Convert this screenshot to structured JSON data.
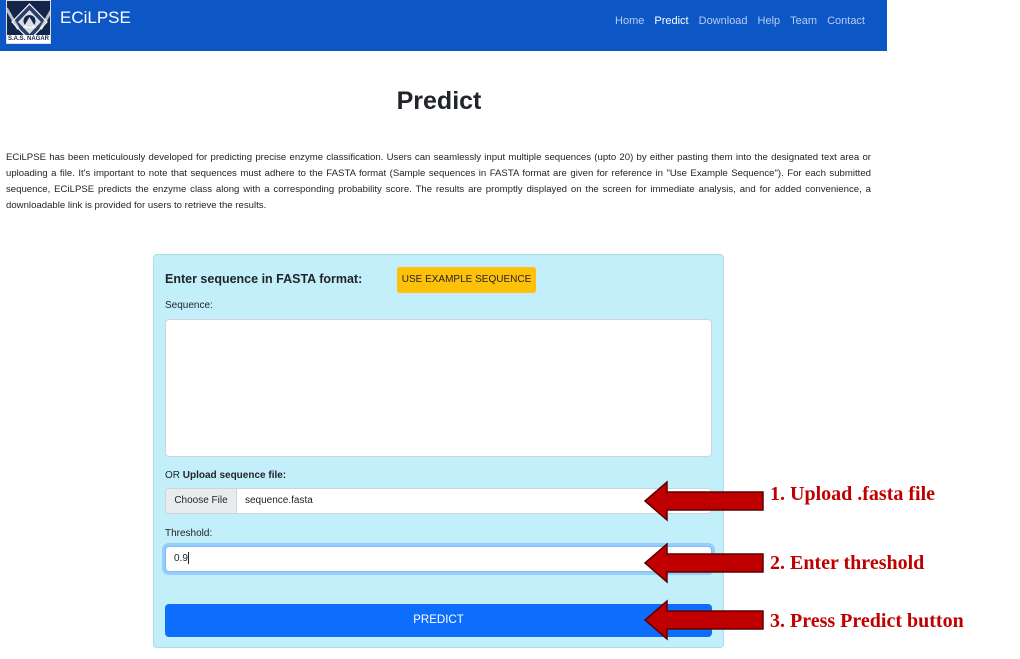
{
  "navbar": {
    "logo_caption": "S.A.S. NAGAR",
    "brand": "ECiLPSE",
    "links": [
      "Home",
      "Predict",
      "Download",
      "Help",
      "Team",
      "Contact"
    ],
    "active_link": "Predict"
  },
  "page": {
    "title": "Predict",
    "intro": "ECiLPSE has been meticulously developed for predicting precise enzyme classification. Users can seamlessly input multiple sequences (upto 20) by either pasting them into the designated text area or uploading a file. It's important to note that sequences must adhere to the FASTA format (Sample sequences in FASTA format are given for reference in \"Use Example Sequence\"). For each submitted sequence, ECiLPSE predicts the enzyme class along with a corresponding probability score. The results are promptly displayed on the screen for immediate analysis, and for added convenience, a downloadable link is provided for users to retrieve the results."
  },
  "form": {
    "heading": "Enter sequence in FASTA format:",
    "example_button": "USE EXAMPLE SEQUENCE",
    "sequence_label": "Sequence:",
    "sequence_value": "",
    "upload_or": "OR ",
    "upload_label": "Upload sequence file:",
    "choose_file": "Choose File",
    "file_name": "sequence.fasta",
    "threshold_label": "Threshold:",
    "threshold_value": "0.9",
    "predict_button": "PREDICT"
  },
  "annotations": {
    "step1": "1. Upload .fasta file",
    "step2": "2. Enter threshold",
    "step3": "3. Press Predict button"
  },
  "colors": {
    "navbar": "#0d56c5",
    "card_bg": "#c2eff9",
    "example_button": "#ffc107",
    "predict_button": "#0d6efd",
    "annotation_red": "#c00000"
  }
}
